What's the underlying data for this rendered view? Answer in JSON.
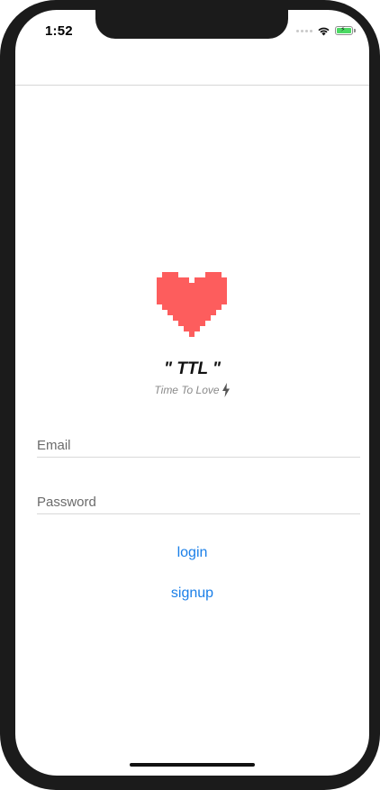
{
  "status_bar": {
    "time": "1:52",
    "wifi_icon": "wifi-icon",
    "battery_icon": "battery-charging-icon",
    "battery_color": "#4cd964"
  },
  "logo": {
    "icon": "pixel-heart-icon",
    "color": "#fd5d5d"
  },
  "app": {
    "title": "\" TTL \"",
    "subtitle": "Time To Love",
    "subtitle_icon": "lightning-bolt-icon"
  },
  "form": {
    "email_placeholder": "Email",
    "email_value": "",
    "password_placeholder": "Password",
    "password_value": ""
  },
  "actions": {
    "login_label": "login",
    "signup_label": "signup",
    "accent_color": "#1a7fe8"
  }
}
